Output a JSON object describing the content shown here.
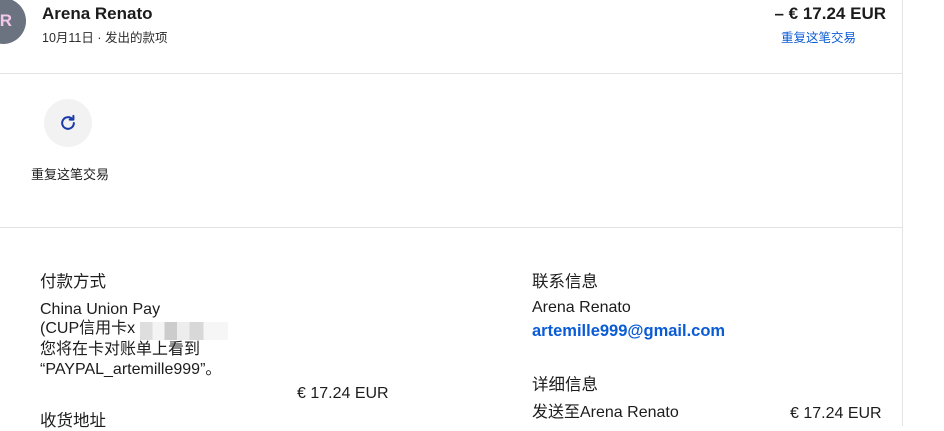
{
  "header": {
    "avatar_initials": "AR",
    "name": "Arena Renato",
    "subtitle": "10月11日 · 发出的款项",
    "amount": "– € 17.24 EUR",
    "repeat_link": "重复这笔交易"
  },
  "actions": {
    "repeat_label": "重复这笔交易",
    "repeat_icon": "refresh-icon"
  },
  "payment": {
    "title": "付款方式",
    "method_line1": "China Union Pay",
    "method_line2": "(CUP信用卡x",
    "statement_line1": "您将在卡对账单上看到",
    "statement_line2": "“PAYPAL_artemille999”。",
    "amount": "€ 17.24 EUR"
  },
  "shipping": {
    "title": "收货地址"
  },
  "contact": {
    "title": "联系信息",
    "name": "Arena Renato",
    "email": "artemille999@gmail.com"
  },
  "details": {
    "title": "详细信息",
    "sent_to": "发送至Arena Renato",
    "amount": "€ 17.24 EUR"
  },
  "colors": {
    "link": "#0a5bd6",
    "avatar_bg": "#6b7280",
    "divider": "#e3e3e3"
  }
}
